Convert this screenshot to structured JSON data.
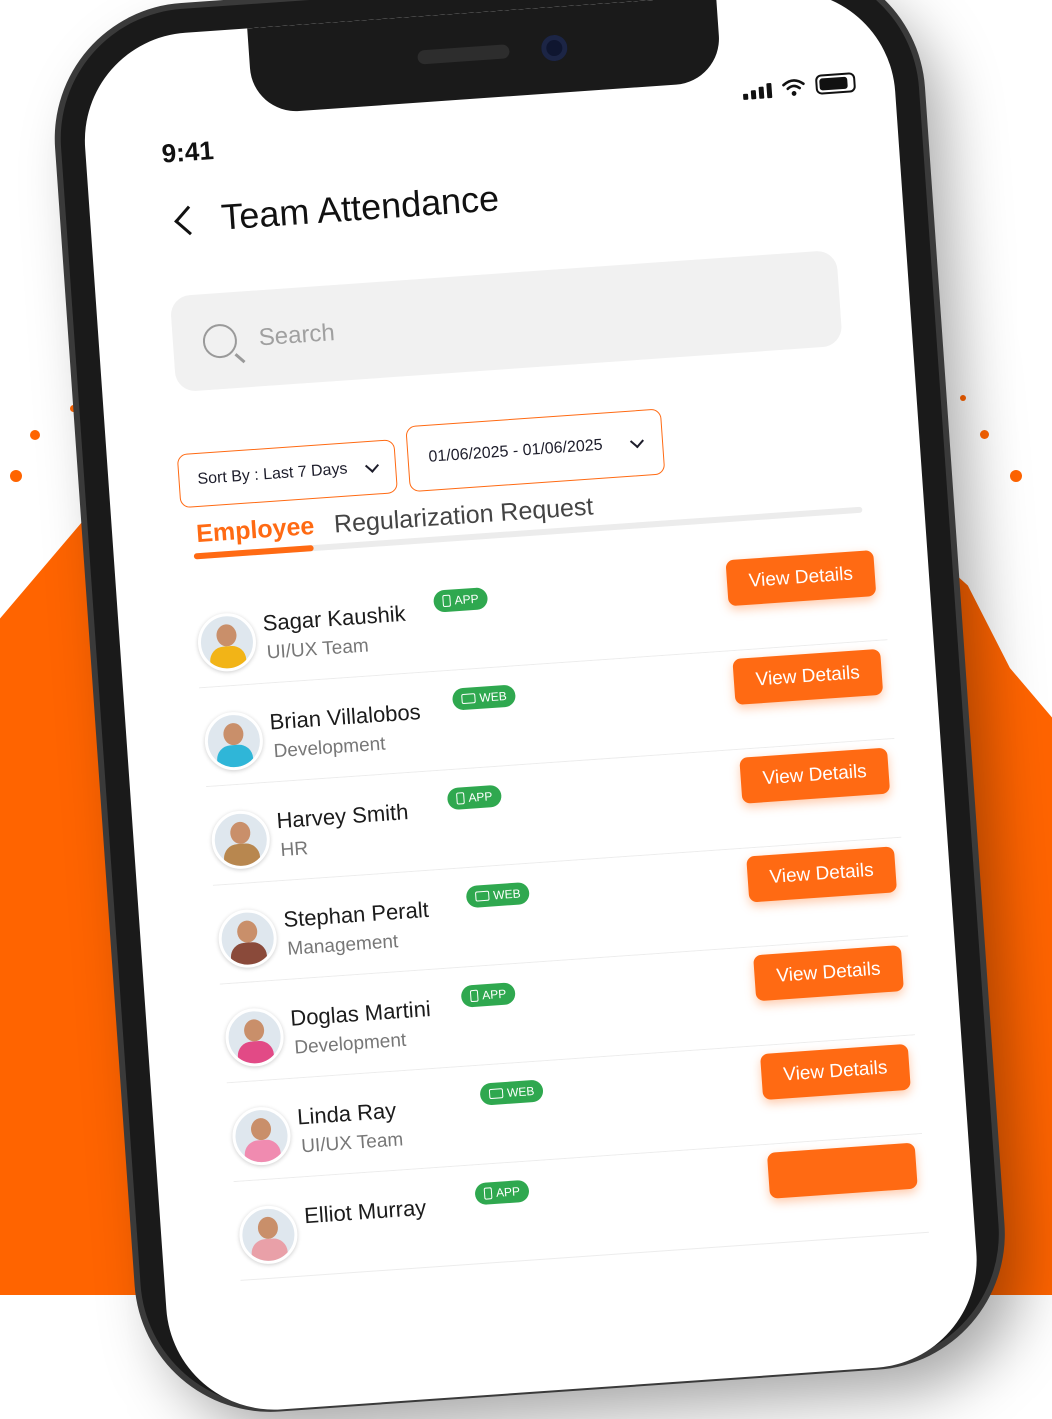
{
  "status_bar": {
    "time": "9:41"
  },
  "header": {
    "title": "Team Attendance"
  },
  "search": {
    "placeholder": "Search"
  },
  "filters": {
    "sort_label": "Sort By : Last 7 Days",
    "date_range": "01/06/2025 - 01/06/2025"
  },
  "tabs": [
    {
      "label": "Employee",
      "active": true
    },
    {
      "label": "Regularization Request",
      "active": false
    }
  ],
  "employees": [
    {
      "name": "Sagar Kaushik",
      "team": "UI/UX Team",
      "source": "APP",
      "action": "View Details",
      "avatar_color": "#f2b417"
    },
    {
      "name": "Brian Villalobos",
      "team": "Development",
      "source": "WEB",
      "action": "View Details",
      "avatar_color": "#2fb6d8"
    },
    {
      "name": "Harvey Smith",
      "team": "HR",
      "source": "APP",
      "action": "View Details",
      "avatar_color": "#b8874f"
    },
    {
      "name": "Stephan Peralt",
      "team": "Management",
      "source": "WEB",
      "action": "View Details",
      "avatar_color": "#8a4a3a"
    },
    {
      "name": "Doglas Martini",
      "team": "Development",
      "source": "APP",
      "action": "View Details",
      "avatar_color": "#e24a86"
    },
    {
      "name": "Linda Ray",
      "team": "UI/UX Team",
      "source": "WEB",
      "action": "View Details",
      "avatar_color": "#f08bb0"
    },
    {
      "name": "Elliot Murray",
      "team": "",
      "source": "APP",
      "action": "",
      "avatar_color": "#e9a0a8"
    }
  ],
  "colors": {
    "accent": "#ff6a13",
    "badge": "#2fa84f",
    "background_splash": "#ff6400"
  }
}
